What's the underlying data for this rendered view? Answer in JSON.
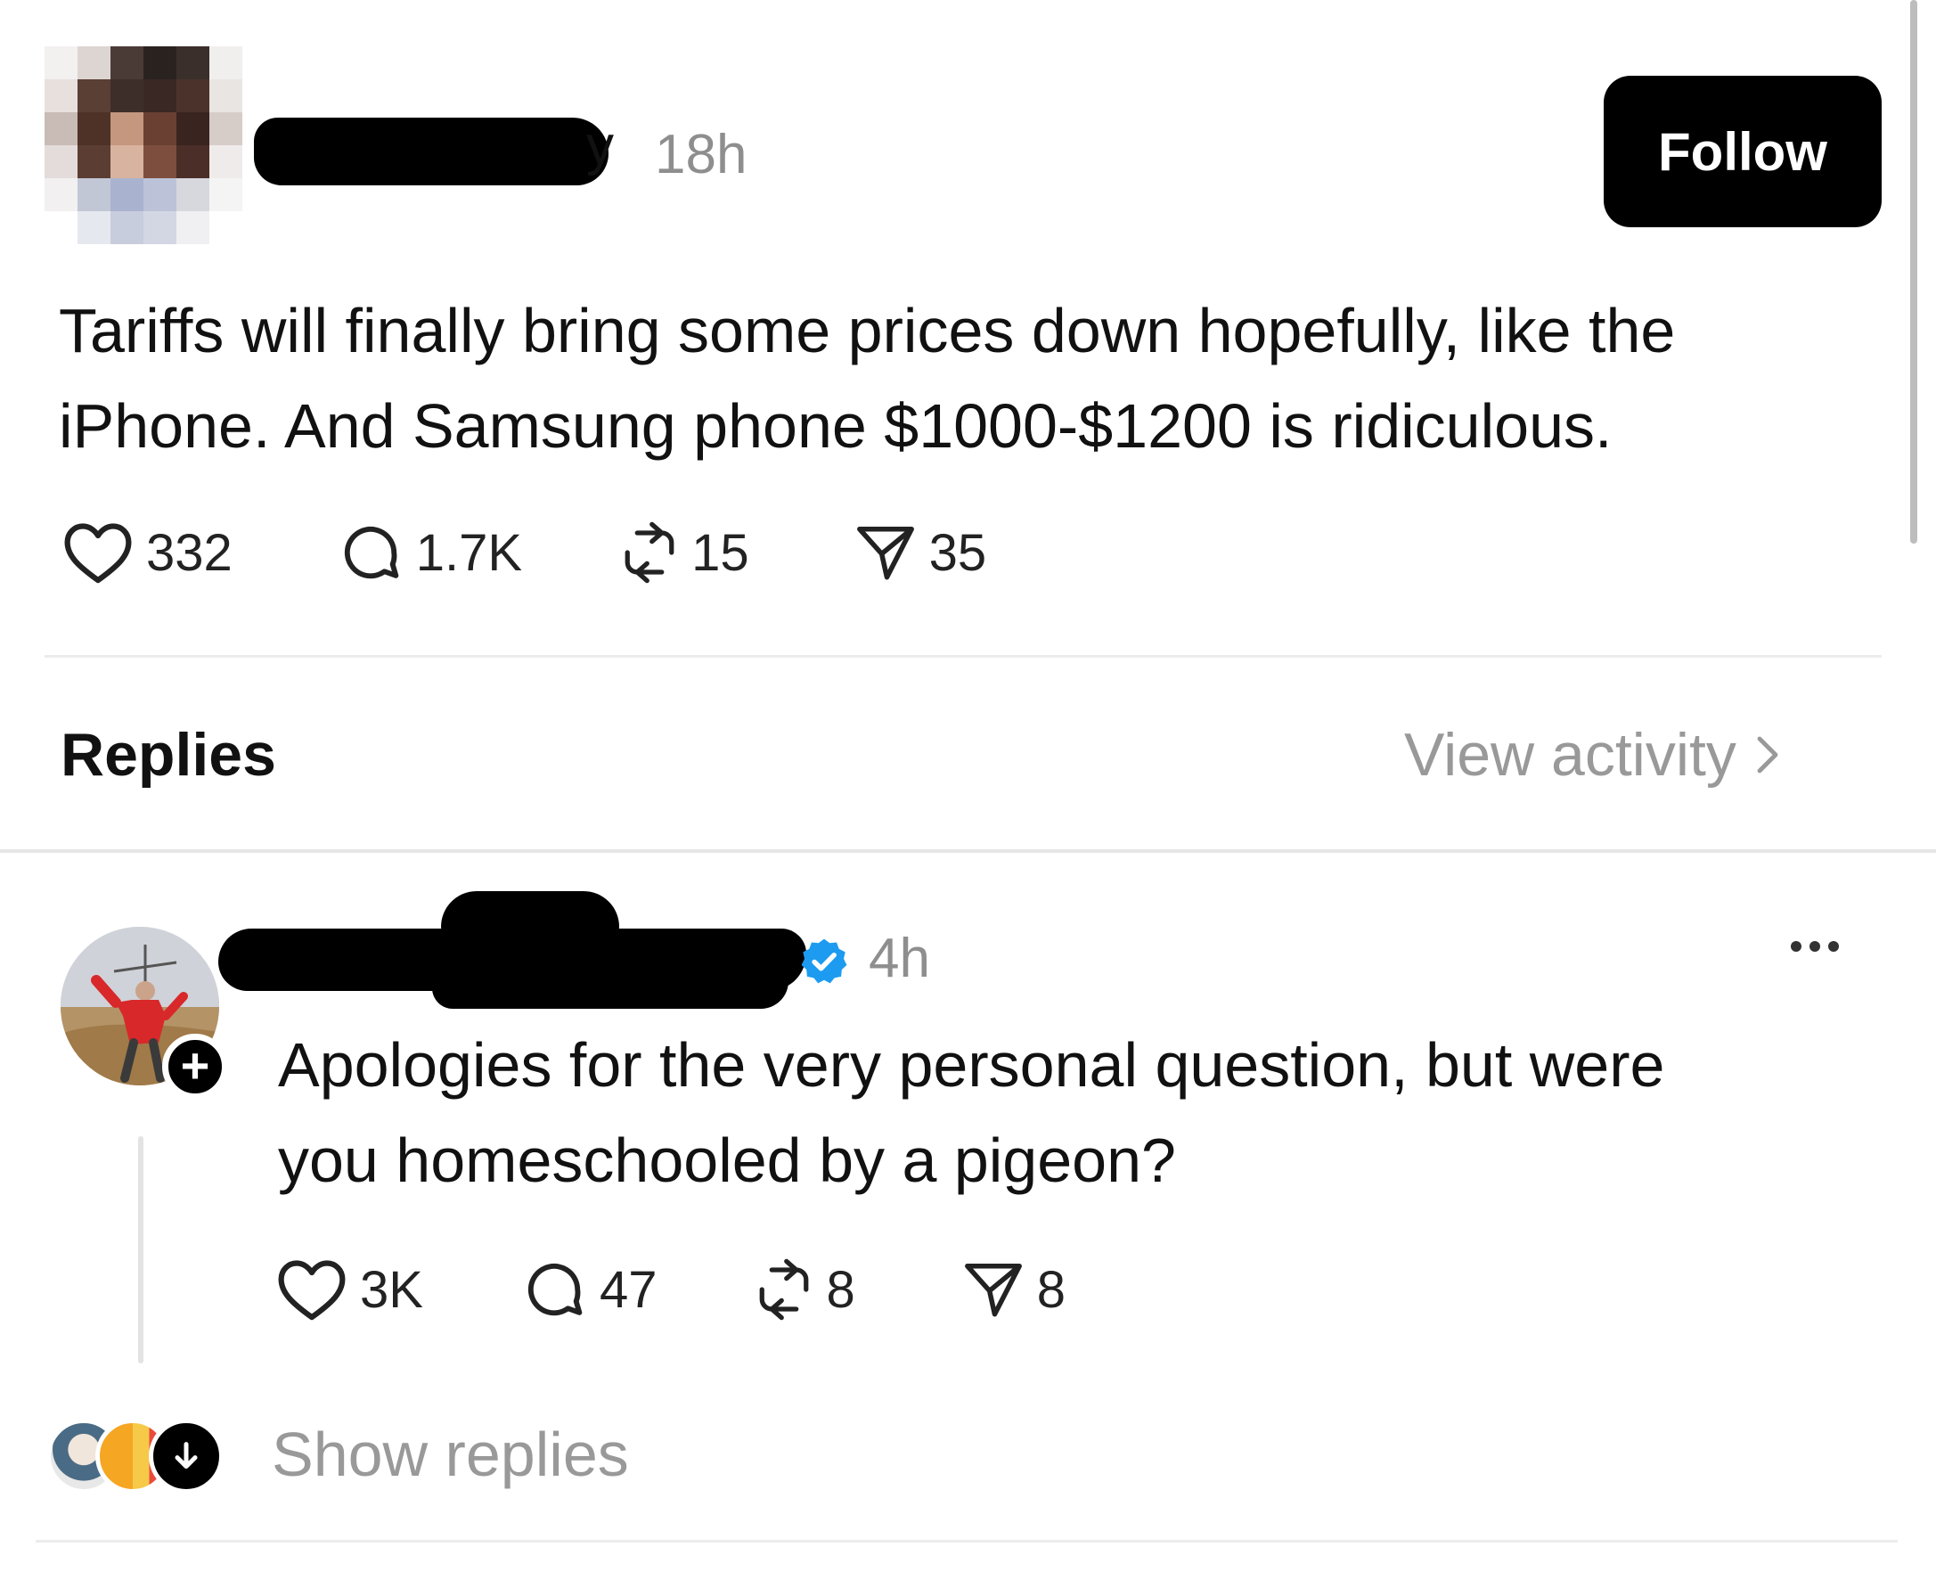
{
  "post": {
    "username_tail": "y",
    "time": "18h",
    "follow_label": "Follow",
    "text_line1": "Tariffs will finally bring some prices down hopefully, like the",
    "text_line2": "iPhone. And Samsung phone $1000-$1200 is ridiculous.",
    "likes": "332",
    "comments": "1.7K",
    "reposts": "15",
    "shares": "35"
  },
  "replies_header": {
    "title": "Replies",
    "view_activity": "View activity"
  },
  "reply": {
    "time": "4h",
    "plus_badge": "+",
    "text_line1": "Apologies for the very personal question, but were",
    "text_line2": "you homeschooled by a pigeon?",
    "likes": "3K",
    "comments": "47",
    "reposts": "8",
    "shares": "8",
    "show_replies": "Show replies"
  },
  "icons": {
    "like": "heart-icon",
    "comment": "comment-bubble-icon",
    "repost": "repost-icon",
    "share": "send-icon",
    "verified": "verified-badge-icon",
    "more": "more-dots-icon"
  },
  "colors": {
    "text": "#111111",
    "muted": "#999999",
    "verified_blue": "#1d9bf0",
    "follow_bg": "#000000"
  }
}
